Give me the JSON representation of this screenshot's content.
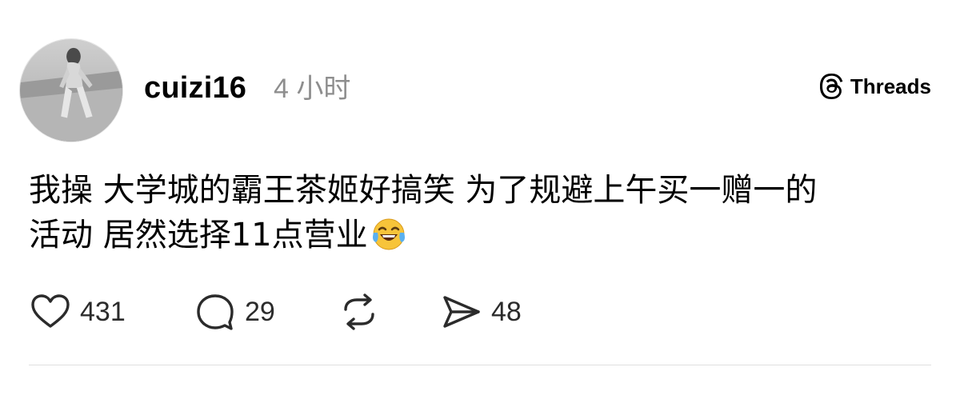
{
  "post": {
    "author": {
      "username": "cuizi16",
      "avatar_icon": "avatar-photo"
    },
    "timestamp": "4 小时",
    "platform": {
      "name": "Threads",
      "logo_icon": "threads-logo-icon"
    },
    "body": {
      "line1": "我操 大学城的霸王茶姬好搞笑 为了规避上午买一赠一的",
      "line2": "活动 居然选择11点营业",
      "emoji": "face-with-tears-of-joy"
    },
    "actions": {
      "likes": "431",
      "comments": "29",
      "shares": "48",
      "like_icon": "heart-icon",
      "comment_icon": "comment-bubble-icon",
      "repost_icon": "repost-icon",
      "share_icon": "send-icon"
    }
  }
}
